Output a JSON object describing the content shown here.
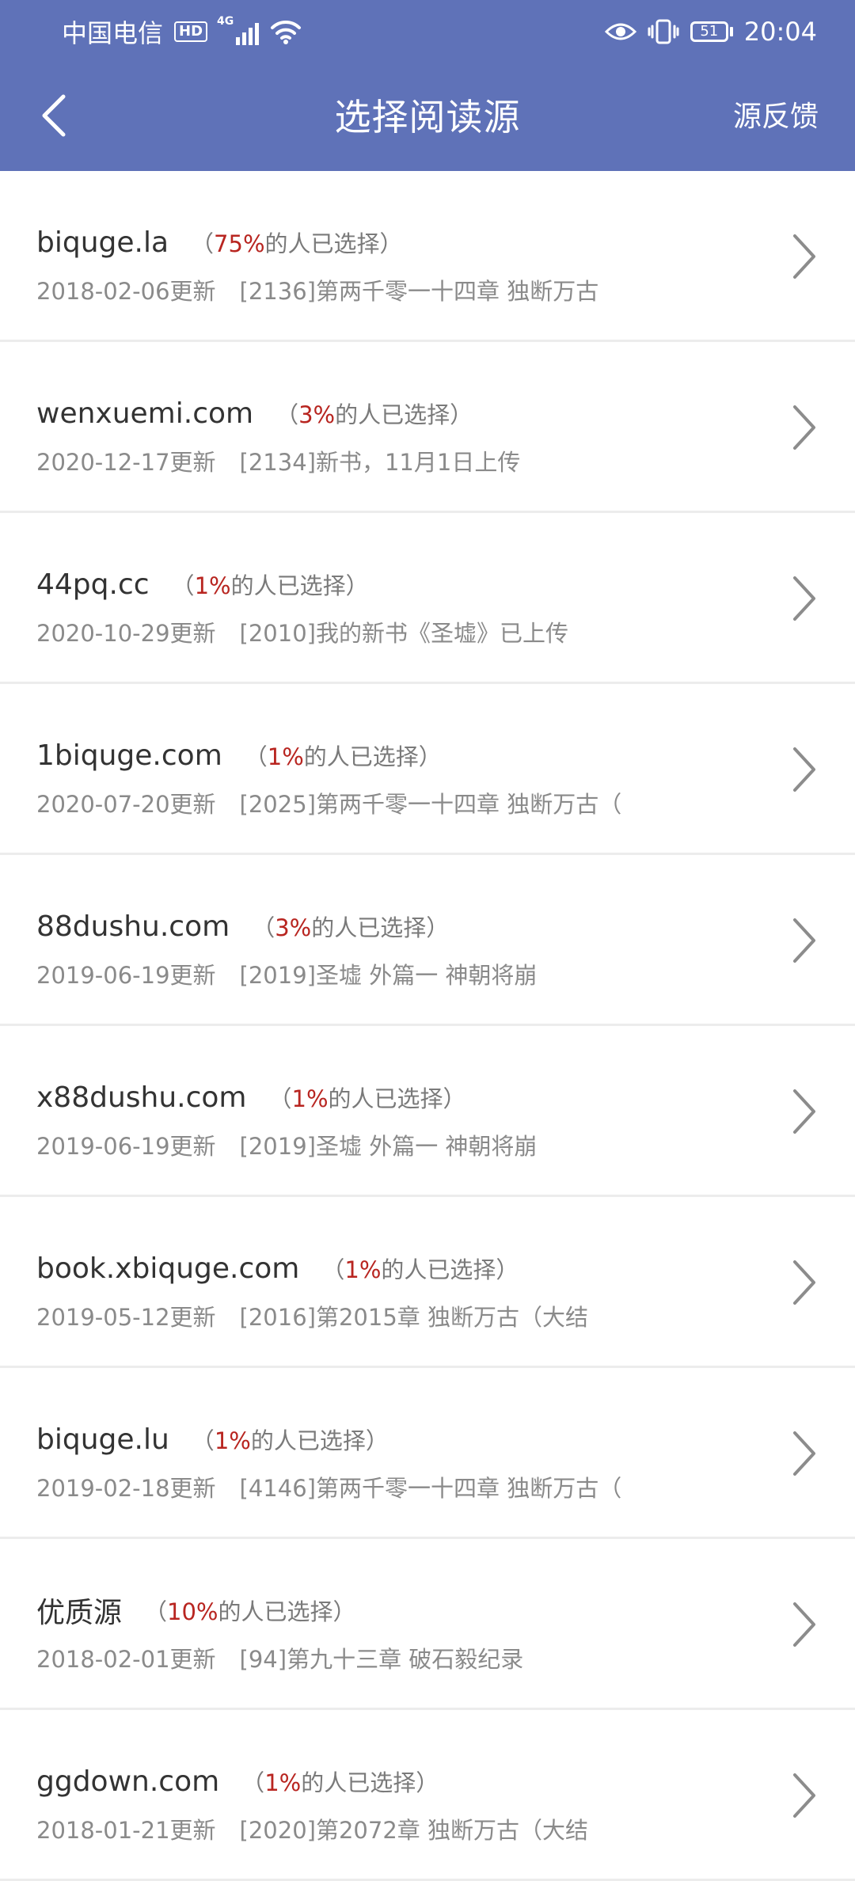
{
  "status_bar": {
    "carrier": "中国电信",
    "hd_badge": "HD",
    "network": "4G",
    "battery": "51",
    "time": "20:04"
  },
  "nav": {
    "title": "选择阅读源",
    "feedback": "源反馈"
  },
  "sources": [
    {
      "name": "biquge.la",
      "open": "（",
      "percent": "75%",
      "suffix": "的人已选择）",
      "date": "2018-02-06更新",
      "chapter": "[2136]第两千零一十四章 独断万古"
    },
    {
      "name": "wenxuemi.com",
      "open": "（",
      "percent": "3%",
      "suffix": "的人已选择）",
      "date": "2020-12-17更新",
      "chapter": "[2134]新书，11月1日上传"
    },
    {
      "name": "44pq.cc",
      "open": "（",
      "percent": "1%",
      "suffix": "的人已选择）",
      "date": "2020-10-29更新",
      "chapter": "[2010]我的新书《圣墟》已上传"
    },
    {
      "name": "1biquge.com",
      "open": "（",
      "percent": "1%",
      "suffix": "的人已选择）",
      "date": "2020-07-20更新",
      "chapter": "[2025]第两千零一十四章 独断万古（"
    },
    {
      "name": "88dushu.com",
      "open": "（",
      "percent": "3%",
      "suffix": "的人已选择）",
      "date": "2019-06-19更新",
      "chapter": "[2019]圣墟 外篇一 神朝将崩"
    },
    {
      "name": "x88dushu.com",
      "open": "（",
      "percent": "1%",
      "suffix": "的人已选择）",
      "date": "2019-06-19更新",
      "chapter": "[2019]圣墟 外篇一 神朝将崩"
    },
    {
      "name": "book.xbiquge.com",
      "open": "（",
      "percent": "1%",
      "suffix": "的人已选择）",
      "date": "2019-05-12更新",
      "chapter": "[2016]第2015章 独断万古（大结"
    },
    {
      "name": "biquge.lu",
      "open": "（",
      "percent": "1%",
      "suffix": "的人已选择）",
      "date": "2019-02-18更新",
      "chapter": "[4146]第两千零一十四章 独断万古（"
    },
    {
      "name": "优质源",
      "open": "（",
      "percent": "10%",
      "suffix": "的人已选择）",
      "date": "2018-02-01更新",
      "chapter": "[94]第九十三章 破石毅纪录"
    },
    {
      "name": "ggdown.com",
      "open": "（",
      "percent": "1%",
      "suffix": "的人已选择）",
      "date": "2018-01-21更新",
      "chapter": "[2020]第2072章 独断万古（大结"
    }
  ],
  "colors": {
    "header_bg": "#5f72b8",
    "percent": "#b82520",
    "secondary_text": "#8a8a8a"
  },
  "icons": [
    "hd-icon",
    "signal-icon",
    "wifi-icon",
    "eye-icon",
    "vibrate-icon",
    "battery-icon",
    "back-arrow-icon",
    "chevron-right-icon"
  ]
}
